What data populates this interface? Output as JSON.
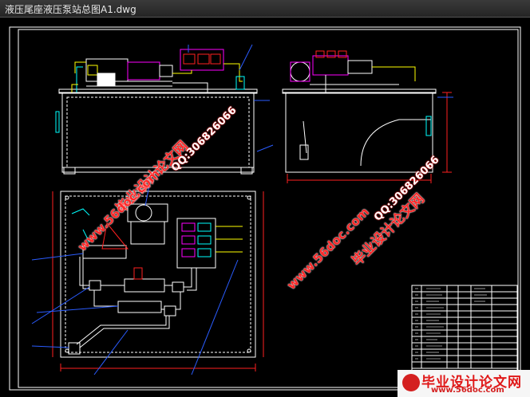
{
  "window": {
    "title": "液压尾座液压泵站总图A1.dwg"
  },
  "watermarks": {
    "site_name": "毕业设计论文网",
    "site_url": "www.56doc.com",
    "qq": "QQ:306826066"
  },
  "logo": {
    "main": "毕业设计论文网",
    "url": "www.56doc.com"
  },
  "colors": {
    "background": "#000000",
    "frame": "#ffffff",
    "outline": "#ffffff",
    "accent_blue": "#2a5cff",
    "accent_yellow": "#ffff00",
    "accent_cyan": "#00ffff",
    "accent_magenta": "#ff00ff",
    "accent_green": "#00ff00",
    "watermark_red": "#ff2828"
  }
}
